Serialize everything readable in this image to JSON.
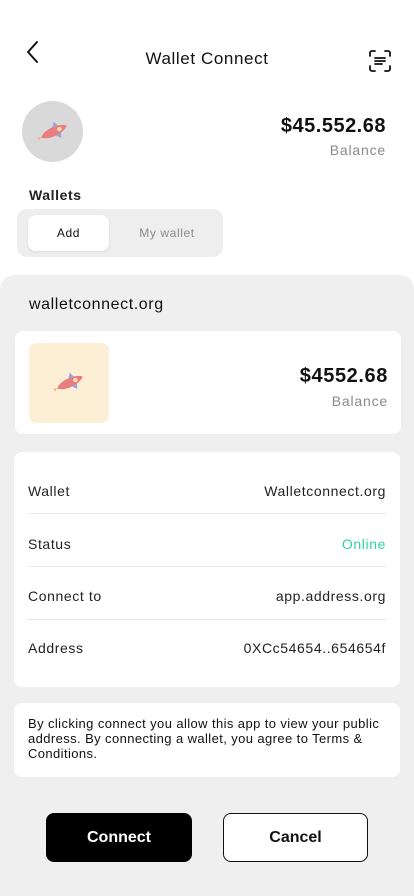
{
  "header": {
    "title": "Wallet Connect",
    "back_icon": "chevron-left-icon",
    "scan_icon": "scan-icon"
  },
  "account": {
    "avatar_icon": "rocket-icon",
    "balance": "$45.552.68",
    "balance_label": "Balance"
  },
  "wallets": {
    "label": "Wallets",
    "tabs": [
      {
        "label": "Add",
        "selected": true
      },
      {
        "label": "My wallet",
        "selected": false
      }
    ]
  },
  "connection": {
    "site": "walletconnect.org",
    "app_icon": "rocket-icon",
    "balance": "$4552.68",
    "balance_label": "Balance",
    "details": [
      {
        "key": "Wallet",
        "value": "Walletconnect.org"
      },
      {
        "key": "Status",
        "value": "Online"
      },
      {
        "key": "Connect to",
        "value": "app.address.org"
      },
      {
        "key": "Address",
        "value": "0XCc54654..654654f"
      }
    ],
    "note": "By clicking connect you allow this app to view your public address. By connecting a wallet, you agree to Terms & Conditions."
  },
  "actions": {
    "connect_label": "Connect",
    "cancel_label": "Cancel"
  },
  "colors": {
    "accent": "#000000",
    "online": "#2FD3A0",
    "sheet_bg": "#EFEFEF",
    "app_icon_bg": "#FCEFD6"
  }
}
